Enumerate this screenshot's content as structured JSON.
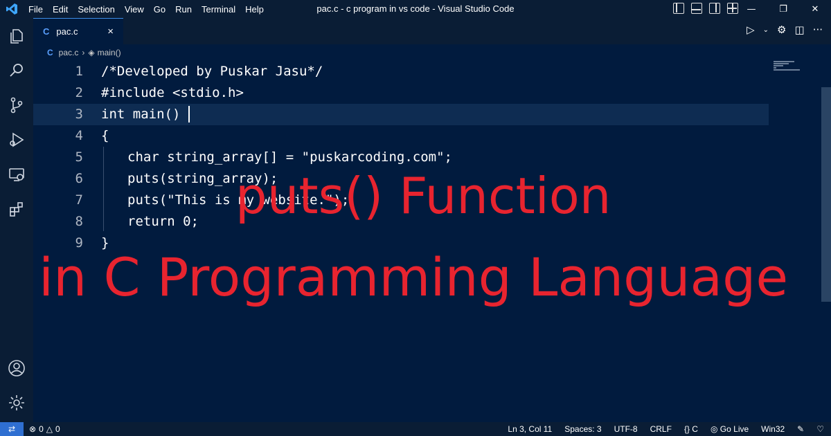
{
  "window": {
    "title": "pac.c - c program in vs code - Visual Studio Code",
    "menu": [
      "File",
      "Edit",
      "Selection",
      "View",
      "Go",
      "Run",
      "Terminal",
      "Help"
    ]
  },
  "tab": {
    "label": "pac.c",
    "icon": "C"
  },
  "breadcrumb": {
    "file": "pac.c",
    "symbol": "main()"
  },
  "editor": {
    "lines": [
      {
        "num": "1",
        "text": "/*Developed by Puskar Jasu*/"
      },
      {
        "num": "2",
        "text": "#include <stdio.h>"
      },
      {
        "num": "3",
        "text": "int main()"
      },
      {
        "num": "4",
        "text": "{"
      },
      {
        "num": "5",
        "text": "char string_array[] = \"puskarcoding.com\";"
      },
      {
        "num": "6",
        "text": "puts(string_array);"
      },
      {
        "num": "7",
        "text": "puts(\"This is my website.\");"
      },
      {
        "num": "8",
        "text": "return 0;"
      },
      {
        "num": "9",
        "text": "}"
      }
    ]
  },
  "overlay": {
    "line1": "puts() Function",
    "line2": "in C Programming Language"
  },
  "status": {
    "errors": "0",
    "warnings": "0",
    "position": "Ln 3, Col 11",
    "spaces": "Spaces: 3",
    "encoding": "UTF-8",
    "eol": "CRLF",
    "language": "C",
    "golive": "Go Live",
    "platform": "Win32"
  },
  "colors": {
    "background": "#011b3e",
    "chrome": "#0a1d35",
    "overlay_text": "#e8242f",
    "accent": "#2f6fd1"
  },
  "icons": [
    "vscode-logo-icon",
    "explorer-icon",
    "search-icon",
    "source-control-icon",
    "run-debug-icon",
    "remote-explorer-icon",
    "extensions-icon",
    "account-icon",
    "settings-gear-icon"
  ]
}
